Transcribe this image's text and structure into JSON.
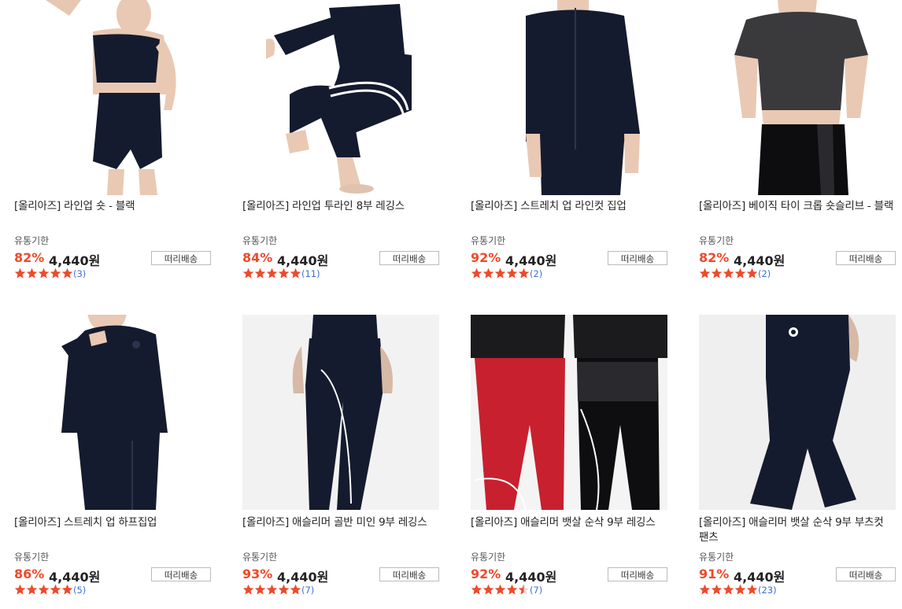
{
  "products": [
    {
      "name": "[올리아즈] 라인업 숏 - 블랙",
      "expiry": "유통기한",
      "discount": "82%",
      "price": "4,440원",
      "shipping": "떠리배송",
      "rating": 5,
      "reviews": "(3)",
      "image": "black-bike-shorts-crop-top"
    },
    {
      "name": "[올리아즈] 라인업 투라인 8부 레깅스",
      "expiry": "유통기한",
      "discount": "84%",
      "price": "4,440원",
      "shipping": "떠리배송",
      "rating": 5,
      "reviews": "(11)",
      "image": "navy-leggings-two-stripes"
    },
    {
      "name": "[올리아즈] 스트레치 업 라인컷 집업",
      "expiry": "유통기한",
      "discount": "92%",
      "price": "4,440원",
      "shipping": "떠리배송",
      "rating": 5,
      "reviews": "(2)",
      "image": "navy-zip-jacket"
    },
    {
      "name": "[올리아즈] 베이직 타이 크롭 숏슬리브 - 블랙",
      "expiry": "유통기한",
      "discount": "82%",
      "price": "4,440원",
      "shipping": "떠리배송",
      "rating": 5,
      "reviews": "(2)",
      "image": "charcoal-crop-tee"
    },
    {
      "name": "[올리아즈] 스트레치 업 하프집업",
      "expiry": "유통기한",
      "discount": "86%",
      "price": "4,440원",
      "shipping": "떠리배송",
      "rating": 5,
      "reviews": "(5)",
      "image": "navy-half-zip"
    },
    {
      "name": "[올리아즈] 애슬리머 골반 미인 9부 레깅스",
      "expiry": "유통기한",
      "discount": "93%",
      "price": "4,440원",
      "shipping": "떠리배송",
      "rating": 5,
      "reviews": "(7)",
      "image": "black-leggings-side-line"
    },
    {
      "name": "[올리아즈] 애슬리머 뱃살 순삭 9부 레깅스",
      "expiry": "유통기한",
      "discount": "92%",
      "price": "4,440원",
      "shipping": "떠리배송",
      "rating": 4.5,
      "reviews": "(7)",
      "image": "red-and-black-leggings"
    },
    {
      "name": "[올리아즈] 애슬리머 뱃살 순삭 9부 부츠컷 팬츠",
      "expiry": "유통기한",
      "discount": "91%",
      "price": "4,440원",
      "shipping": "떠리배송",
      "rating": 5,
      "reviews": "(23)",
      "image": "black-bootcut-pants"
    }
  ],
  "colors": {
    "discount": "#ee4a2b",
    "star": "#ee4a2b",
    "review_count": "#3b6fd4",
    "navy": "#151b2e"
  }
}
